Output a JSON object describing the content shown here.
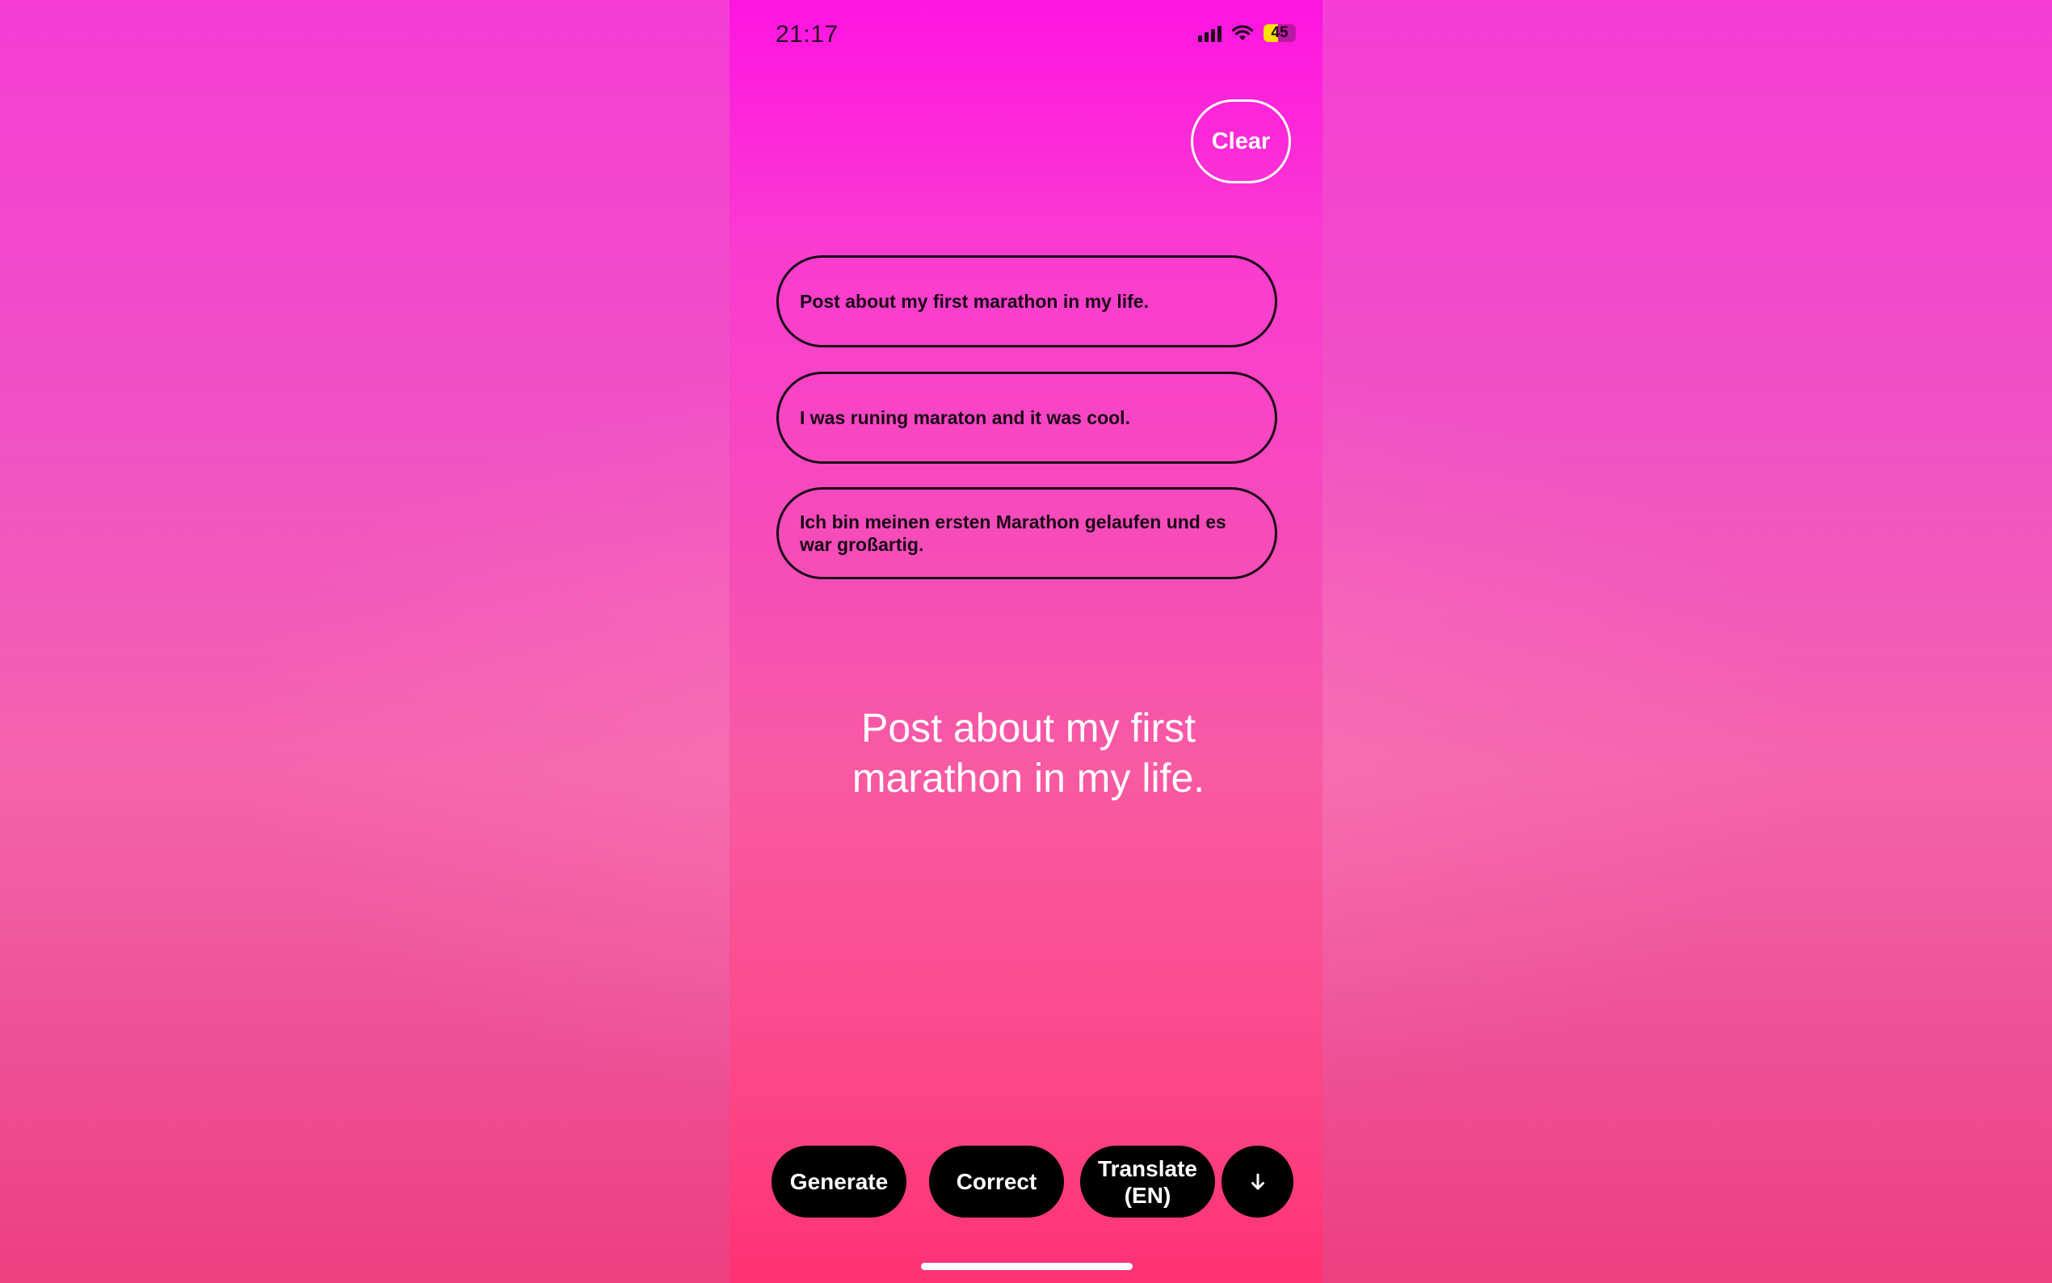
{
  "status_bar": {
    "time": "21:17",
    "battery_level": "45",
    "icons": [
      "signal-icon",
      "wifi-icon",
      "battery-icon"
    ]
  },
  "toolbar": {
    "clear_label": "Clear"
  },
  "options": [
    {
      "text": "Post about my first marathon in my life."
    },
    {
      "text": "I was runing maraton and it was cool."
    },
    {
      "text": "Ich bin meinen ersten Marathon gelaufen und es war großartig."
    }
  ],
  "main_text": "Post about my first marathon in my life.",
  "bottom_bar": {
    "generate_label": "Generate",
    "correct_label": "Correct",
    "translate_label_line1": "Translate",
    "translate_label_line2": "(EN)",
    "down_icon": "arrow-down-icon"
  },
  "colors": {
    "accent_top": "#ff14e1",
    "accent_bottom": "#ff3275",
    "button_bg": "#000000",
    "battery_fill": "#ffe100"
  }
}
